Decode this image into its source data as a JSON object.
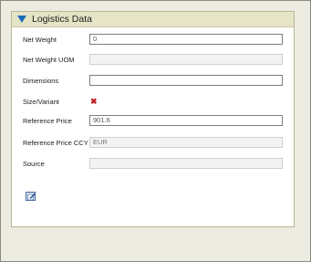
{
  "panel": {
    "title": "Logistics Data",
    "toggle_icon": "collapse-triangle-icon"
  },
  "fields": [
    {
      "label": "Net Weight",
      "value": "0",
      "type": "editable"
    },
    {
      "label": "Net Weight UOM",
      "value": "",
      "type": "readonly"
    },
    {
      "label": "Dimensions",
      "value": "",
      "type": "editable"
    },
    {
      "label": "Size/Variant",
      "value": "✖",
      "type": "icon",
      "icon": "red-x-icon"
    },
    {
      "label": "Reference Price",
      "value": "901.6",
      "type": "editable"
    },
    {
      "label": "Reference Price CCY",
      "value": "EUR",
      "type": "readonly"
    },
    {
      "label": "Source",
      "value": "",
      "type": "readonly"
    }
  ],
  "actions": {
    "edit_icon": "edit-icon"
  },
  "colors": {
    "header_bg": "#e6e4c6",
    "accent": "#1b6db6",
    "error": "#c02020"
  }
}
